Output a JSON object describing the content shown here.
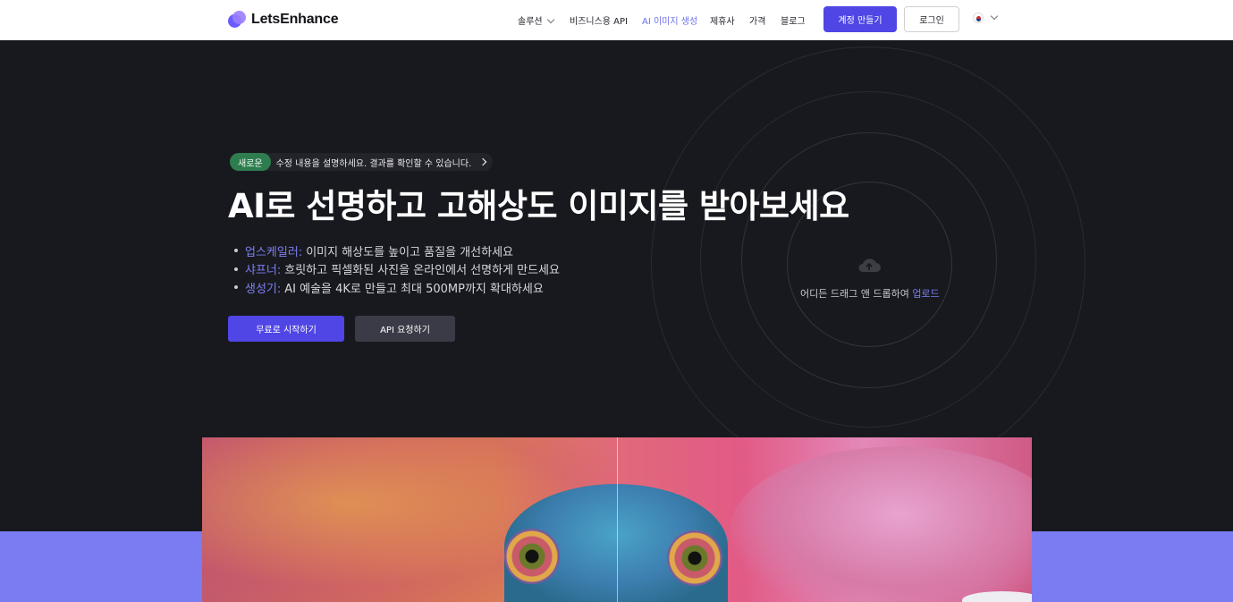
{
  "nav": {
    "logo_text": "LetsEnhance",
    "items": [
      {
        "label": "솔루션",
        "has_dropdown": true
      },
      {
        "label": "비즈니스용 API"
      },
      {
        "label": "AI 이미지 생성",
        "active": true
      },
      {
        "label": "제휴사"
      },
      {
        "label": "가격"
      },
      {
        "label": "블로그"
      }
    ],
    "signup_label": "계정 만들기",
    "login_label": "로그인",
    "language_flag": "korea-flag-icon"
  },
  "hero": {
    "badge_label": "새로운",
    "badge_text": "수정 내용을 설명하세요. 결과를 확인할 수 있습니다.",
    "headline": "AI로 선명하고 고해상도 이미지를 받아보세요",
    "features": [
      {
        "keyword": "업스케일러:",
        "text": "이미지 해상도를 높이고 품질을 개선하세요"
      },
      {
        "keyword": "샤프너:",
        "text": "흐릿하고 픽셀화된 사진을 온라인에서 선명하게 만드세요"
      },
      {
        "keyword": "생성기:",
        "text": "AI 예술을 4K로 만들고 최대 500MP까지 확대하세요"
      }
    ],
    "start_button": "무료로 시작하기",
    "api_button": "API 요청하기",
    "upload_text": "어디든 드래그 앤 드롭하여",
    "upload_link": "업로드"
  },
  "colors": {
    "accent": "#4f46e5",
    "hero_bg": "#18191e",
    "keyword": "#7c80f2",
    "band": "#7b7cf2",
    "badge": "#2e7d4f"
  }
}
